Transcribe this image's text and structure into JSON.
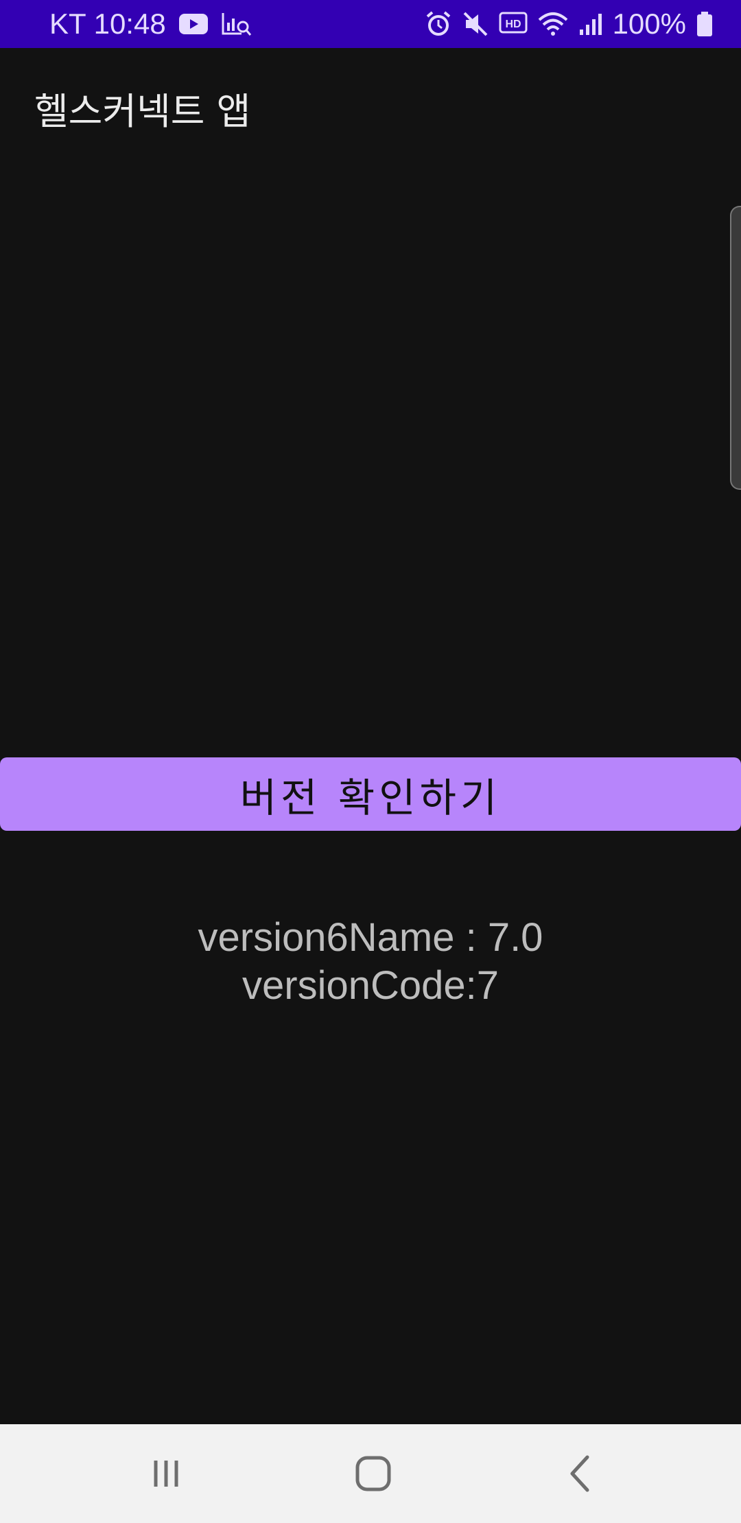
{
  "status_bar": {
    "carrier_time": "KT 10:48",
    "battery": "100%",
    "icons_left": [
      "youtube-icon",
      "analytics-icon"
    ],
    "icons_right": [
      "alarm-icon",
      "mute-icon",
      "hd-icon",
      "wifi-icon",
      "signal-icon",
      "battery-icon"
    ],
    "background": "#3300b3"
  },
  "app": {
    "title": "헬스커넥트 앱",
    "check_version_button": "버전 확인하기",
    "button_color": "#b785fb",
    "version_name_line": "version6Name : 7.0",
    "version_code_line": "versionCode:7"
  },
  "nav_bar": {
    "icons": [
      "recents-icon",
      "home-icon",
      "back-icon"
    ]
  }
}
